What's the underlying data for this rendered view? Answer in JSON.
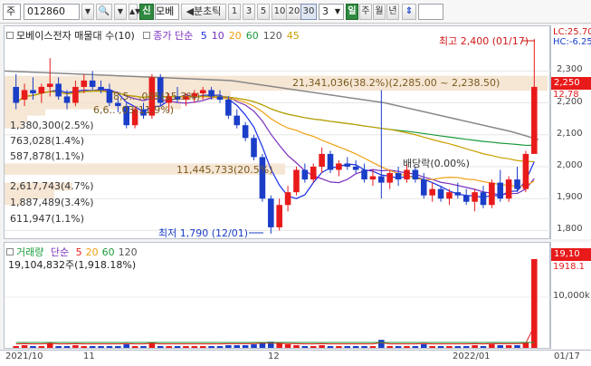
{
  "toolbar": {
    "market": "주",
    "code": "012860",
    "scope_btn": "신",
    "stock_short": "모베",
    "period_label": "◀분초틱",
    "periods": [
      "1",
      "3",
      "5",
      "10",
      "20",
      "30"
    ],
    "count": "3",
    "units": [
      "일",
      "주",
      "월",
      "년"
    ],
    "updown": "⇕"
  },
  "price_panel": {
    "title": "모베이스전자 매물대 수(10)",
    "ma_label": "종가 단순",
    "ma_periods": [
      "5",
      "10",
      "20",
      "60",
      "120",
      "45"
    ],
    "ma_colors": [
      "#1a2ee8",
      "#7b2fbf",
      "#f0a010",
      "#1a9a3a",
      "#555555",
      "#c8a000"
    ],
    "high_note": "최고 2,400 (01/17)",
    "low_note": "최저 1,790 (12/01)",
    "dividend_note": "배당락(0.00%)",
    "volume_profile": [
      "21,341,036(38.2%)(2,285.00 ~ 2,238.50)",
      "8,5..  ,085(15.3%)",
      "6,6..  ,03(11.9%)",
      "1,380,300(2.5%)",
      "763,028(1.4%)",
      "587,878(1.1%)",
      "11,445,733(20.5%)",
      "2,617,743(4.7%)",
      "1,887,489(3.4%)",
      "611,947(1.1%)"
    ],
    "lc": "LC:25.70",
    "hc": "HC:-6.25",
    "current_price": "2,250",
    "prev_marker": "12,78",
    "y_ticks": [
      "2,300",
      "2,200",
      "2,100",
      "2,000",
      "1,900",
      "1,800"
    ]
  },
  "volume_panel": {
    "title": "거래량",
    "ma_label": "단순",
    "ma_periods": [
      "5",
      "20",
      "60",
      "120"
    ],
    "ma_colors": [
      "#e81a1a",
      "#f0a010",
      "#1a9a3a",
      "#555555"
    ],
    "last_volume": "19,104,832주(1,918.18%)",
    "badge_volume": "19,10",
    "badge_pct": "1918.1",
    "y_tick": "10,000k"
  },
  "x_axis": [
    "2021/10",
    "11",
    "12",
    "2022/01",
    "01/17"
  ],
  "chart_data": {
    "type": "candlestick",
    "ylim": [
      1770,
      2440
    ],
    "candles": [
      {
        "o": 2250,
        "h": 2290,
        "l": 2180,
        "c": 2200
      },
      {
        "o": 2210,
        "h": 2260,
        "l": 2190,
        "c": 2240
      },
      {
        "o": 2240,
        "h": 2280,
        "l": 2210,
        "c": 2230
      },
      {
        "o": 2230,
        "h": 2260,
        "l": 2200,
        "c": 2250
      },
      {
        "o": 2250,
        "h": 2340,
        "l": 2220,
        "c": 2260
      },
      {
        "o": 2260,
        "h": 2280,
        "l": 2210,
        "c": 2220
      },
      {
        "o": 2220,
        "h": 2240,
        "l": 2180,
        "c": 2200
      },
      {
        "o": 2200,
        "h": 2270,
        "l": 2190,
        "c": 2250
      },
      {
        "o": 2250,
        "h": 2290,
        "l": 2230,
        "c": 2270
      },
      {
        "o": 2270,
        "h": 2300,
        "l": 2240,
        "c": 2250
      },
      {
        "o": 2250,
        "h": 2270,
        "l": 2230,
        "c": 2240
      },
      {
        "o": 2240,
        "h": 2260,
        "l": 2190,
        "c": 2200
      },
      {
        "o": 2200,
        "h": 2220,
        "l": 2170,
        "c": 2190
      },
      {
        "o": 2190,
        "h": 2200,
        "l": 2120,
        "c": 2130
      },
      {
        "o": 2130,
        "h": 2190,
        "l": 2120,
        "c": 2180
      },
      {
        "o": 2180,
        "h": 2200,
        "l": 2150,
        "c": 2160
      },
      {
        "o": 2160,
        "h": 2290,
        "l": 2150,
        "c": 2280
      },
      {
        "o": 2280,
        "h": 2290,
        "l": 2190,
        "c": 2200
      },
      {
        "o": 2200,
        "h": 2230,
        "l": 2170,
        "c": 2220
      },
      {
        "o": 2220,
        "h": 2250,
        "l": 2200,
        "c": 2210
      },
      {
        "o": 2210,
        "h": 2230,
        "l": 2190,
        "c": 2220
      },
      {
        "o": 2220,
        "h": 2240,
        "l": 2200,
        "c": 2230
      },
      {
        "o": 2230,
        "h": 2250,
        "l": 2210,
        "c": 2240
      },
      {
        "o": 2240,
        "h": 2250,
        "l": 2210,
        "c": 2220
      },
      {
        "o": 2220,
        "h": 2240,
        "l": 2200,
        "c": 2210
      },
      {
        "o": 2210,
        "h": 2220,
        "l": 2150,
        "c": 2160
      },
      {
        "o": 2160,
        "h": 2180,
        "l": 2120,
        "c": 2130
      },
      {
        "o": 2130,
        "h": 2140,
        "l": 2080,
        "c": 2090
      },
      {
        "o": 2090,
        "h": 2100,
        "l": 2020,
        "c": 2030
      },
      {
        "o": 2030,
        "h": 2040,
        "l": 1890,
        "c": 1900
      },
      {
        "o": 1900,
        "h": 1910,
        "l": 1790,
        "c": 1810
      },
      {
        "o": 1810,
        "h": 1900,
        "l": 1800,
        "c": 1880
      },
      {
        "o": 1880,
        "h": 1940,
        "l": 1860,
        "c": 1920
      },
      {
        "o": 1920,
        "h": 2000,
        "l": 1910,
        "c": 1990
      },
      {
        "o": 1990,
        "h": 2010,
        "l": 1950,
        "c": 1960
      },
      {
        "o": 1960,
        "h": 2010,
        "l": 1950,
        "c": 2000
      },
      {
        "o": 2000,
        "h": 2060,
        "l": 1980,
        "c": 2040
      },
      {
        "o": 2040,
        "h": 2050,
        "l": 1980,
        "c": 1990
      },
      {
        "o": 1990,
        "h": 2020,
        "l": 1970,
        "c": 2010
      },
      {
        "o": 2010,
        "h": 2030,
        "l": 1990,
        "c": 2000
      },
      {
        "o": 2000,
        "h": 2020,
        "l": 1980,
        "c": 1990
      },
      {
        "o": 1990,
        "h": 2010,
        "l": 1950,
        "c": 1960
      },
      {
        "o": 1960,
        "h": 1990,
        "l": 1940,
        "c": 1970
      },
      {
        "o": 1970,
        "h": 2240,
        "l": 1900,
        "c": 1950
      },
      {
        "o": 1950,
        "h": 1990,
        "l": 1930,
        "c": 1980
      },
      {
        "o": 1980,
        "h": 2000,
        "l": 1940,
        "c": 1960
      },
      {
        "o": 1960,
        "h": 2010,
        "l": 1950,
        "c": 1990
      },
      {
        "o": 1990,
        "h": 2000,
        "l": 1950,
        "c": 1960
      },
      {
        "o": 1960,
        "h": 1980,
        "l": 1900,
        "c": 1910
      },
      {
        "o": 1910,
        "h": 1950,
        "l": 1890,
        "c": 1930
      },
      {
        "o": 1930,
        "h": 1940,
        "l": 1890,
        "c": 1900
      },
      {
        "o": 1900,
        "h": 1930,
        "l": 1880,
        "c": 1920
      },
      {
        "o": 1920,
        "h": 1950,
        "l": 1900,
        "c": 1910
      },
      {
        "o": 1910,
        "h": 1930,
        "l": 1880,
        "c": 1890
      },
      {
        "o": 1890,
        "h": 1930,
        "l": 1860,
        "c": 1920
      },
      {
        "o": 1920,
        "h": 1940,
        "l": 1870,
        "c": 1880
      },
      {
        "o": 1880,
        "h": 1960,
        "l": 1870,
        "c": 1950
      },
      {
        "o": 1950,
        "h": 1990,
        "l": 1890,
        "c": 1900
      },
      {
        "o": 1900,
        "h": 1970,
        "l": 1890,
        "c": 1960
      },
      {
        "o": 1960,
        "h": 2000,
        "l": 1920,
        "c": 1930
      },
      {
        "o": 1930,
        "h": 2050,
        "l": 1920,
        "c": 2040
      },
      {
        "o": 2040,
        "h": 2400,
        "l": 2120,
        "c": 2250
      }
    ],
    "volume": [
      2,
      3,
      2,
      2,
      5,
      2,
      2,
      3,
      2,
      2,
      2,
      2,
      2,
      4,
      2,
      2,
      6,
      2,
      2,
      2,
      2,
      2,
      2,
      2,
      2,
      3,
      3,
      3,
      4,
      6,
      7,
      5,
      4,
      3,
      2,
      2,
      3,
      2,
      2,
      2,
      2,
      2,
      2,
      9,
      2,
      2,
      2,
      2,
      4,
      2,
      2,
      2,
      2,
      2,
      3,
      2,
      4,
      3,
      3,
      3,
      6,
      100
    ]
  }
}
